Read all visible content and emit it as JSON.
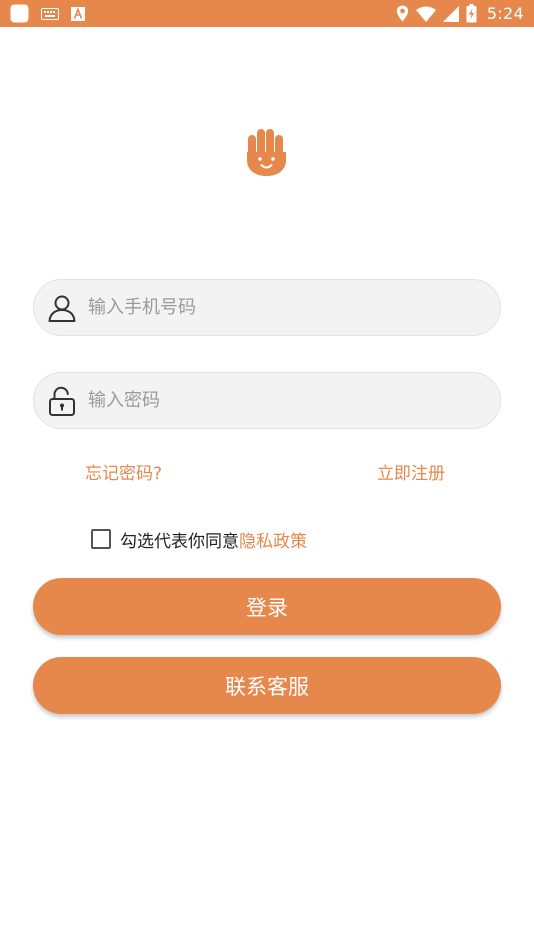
{
  "status_bar": {
    "time": "5:24",
    "icons": [
      "app-notification-icon",
      "keyboard-icon",
      "text-a-icon",
      "location-icon",
      "wifi-icon",
      "signal-icon",
      "battery-charging-icon"
    ]
  },
  "login": {
    "logo": "hand-logo-icon",
    "username": {
      "placeholder": "输入手机号码",
      "value": "",
      "icon": "user-icon"
    },
    "password": {
      "placeholder": "输入密码",
      "value": "",
      "icon": "unlock-icon"
    },
    "forgot_password": "忘记密码?",
    "register": "立即注册",
    "agreement": {
      "checked": false,
      "text": "勾选代表你同意",
      "policy_link": "隐私政策"
    },
    "login_button": "登录",
    "support_button": "联系客服"
  },
  "colors": {
    "accent": "#e6874c",
    "field_bg": "#f3f3f3",
    "placeholder": "#9a9a9a"
  }
}
